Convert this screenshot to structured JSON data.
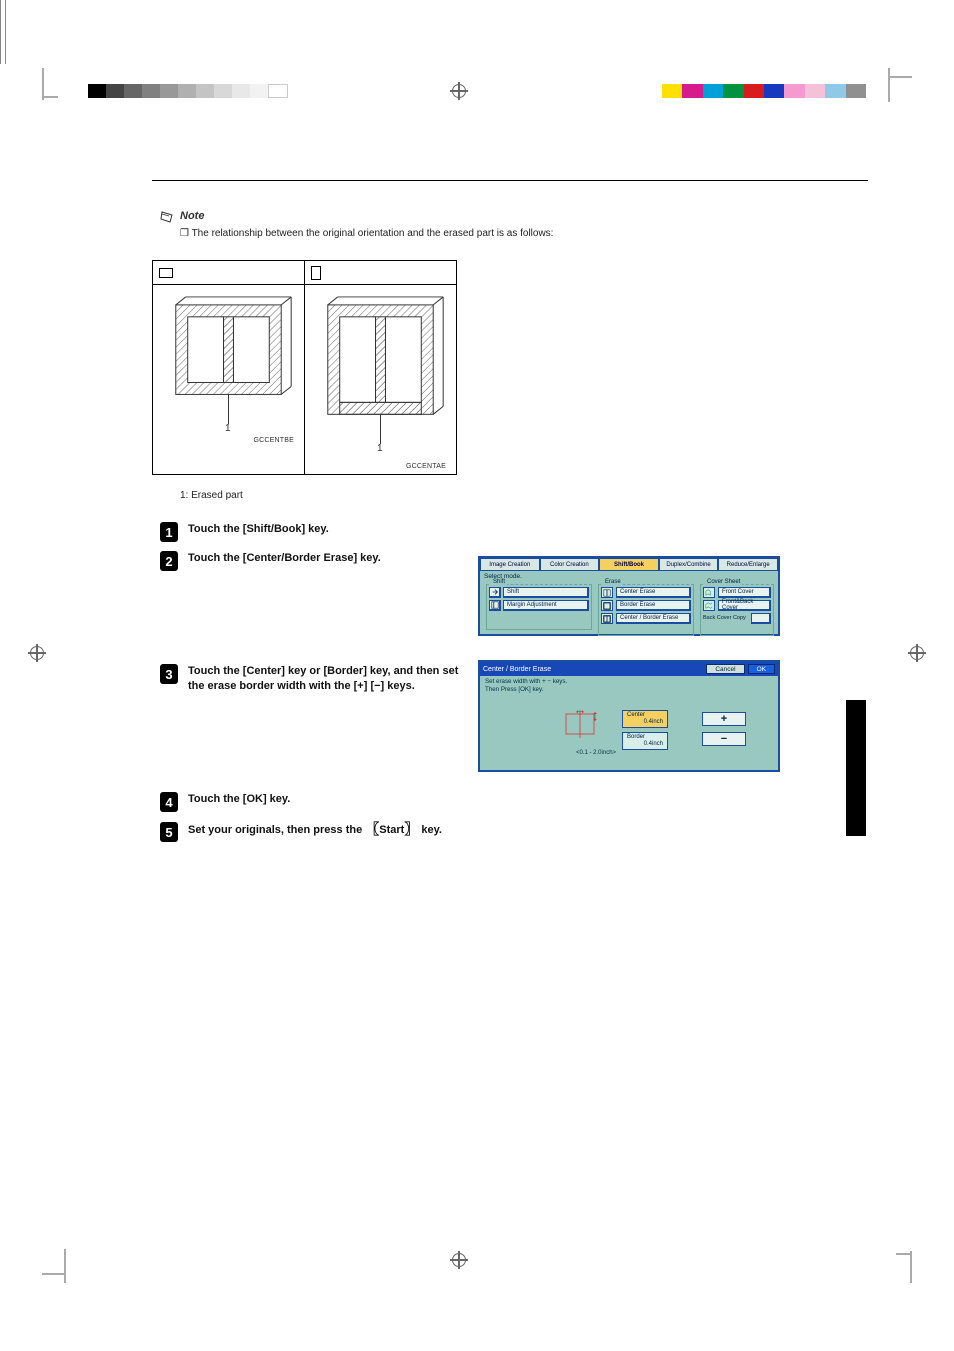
{
  "colors": {
    "graybar": [
      "#000000",
      "#444444",
      "#666666",
      "#808080",
      "#999999",
      "#b0b0b0",
      "#c4c4c4",
      "#d8d8d8",
      "#e8e8e8",
      "#f2f2f2",
      "#ffffff"
    ],
    "colorbar": [
      "#ffe000",
      "#d81b8c",
      "#00a0d8",
      "#009440",
      "#d81b1b",
      "#1838c0",
      "#f49ad0",
      "#f4c2d8",
      "#90c8e8",
      "#909090"
    ]
  },
  "note": {
    "label": "Note",
    "body": "❒ The relationship between the original orientation and the erased part is as follows:"
  },
  "diagram": {
    "left_caption": "GCCENTBE",
    "right_caption": "GCCENTAE",
    "left_num": "1",
    "right_num": "1"
  },
  "erased_label": "1: Erased part",
  "steps": {
    "s1": "Touch the [Shift/Book] key.",
    "s2": "Touch the [Center/Border Erase] key.",
    "s3": "Touch the [Center] key or [Border] key, and then set the erase border width with the [+] [−] keys.",
    "s4": "Touch the [OK] key.",
    "s5_a": "Set your originals, then press the ",
    "s5_b": "Start",
    "s5_c": " key."
  },
  "dialog1": {
    "tabs": [
      "Image Creation",
      "Color Creation",
      "Shift/Book",
      "Duplex/Combine",
      "Reduce/Enlarge"
    ],
    "select_mode": "Select mode.",
    "groups": {
      "shift": {
        "legend": "Shift",
        "shift_btn": "Shift",
        "margin_btn": "Margin Adjustment"
      },
      "erase": {
        "legend": "Erase",
        "center": "Center Erase",
        "border": "Border Erase",
        "center_border": "Center / Border Erase"
      },
      "cover": {
        "legend": "Cover Sheet",
        "front": "Front Cover",
        "frontback": "Front&Back Cover",
        "back_label": "Back Cover Copy"
      }
    }
  },
  "dialog2": {
    "title": "Center / Border Erase",
    "cancel": "Cancel",
    "ok": "OK",
    "hint1": "Set erase width with + − keys.",
    "hint2": "Then Press [OK] key.",
    "range": "<0.1 - 2.0inch>",
    "center_label": "Center",
    "center_value": "0.4inch",
    "border_label": "Border",
    "border_value": "0.4inch",
    "plus": "+",
    "minus": "−"
  }
}
